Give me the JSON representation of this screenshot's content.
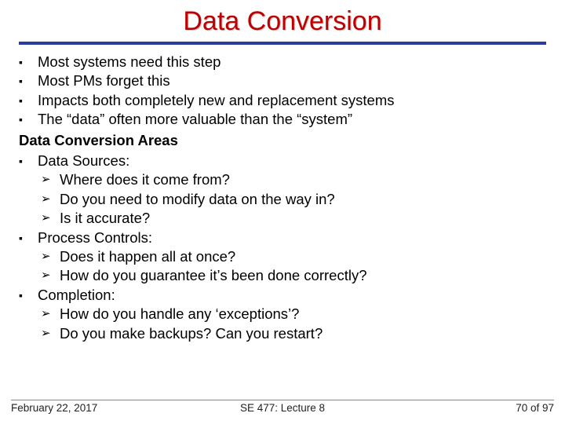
{
  "title": "Data Conversion",
  "bullets": {
    "b1": "Most systems need this step",
    "b2": "Most PMs forget this",
    "b3": "Impacts both completely new and replacement systems",
    "b4": "The “data” often more valuable than the “system”"
  },
  "subhead": "Data Conversion Areas",
  "sections": {
    "s1": {
      "label": "Data Sources:",
      "items": {
        "i1": "Where does it come from?",
        "i2": "Do you need to modify data on the way in?",
        "i3": "Is it accurate?"
      }
    },
    "s2": {
      "label": "Process Controls:",
      "items": {
        "i1": "Does it happen all at once?",
        "i2": "How do you guarantee it’s been done correctly?"
      }
    },
    "s3": {
      "label": "Completion:",
      "items": {
        "i1": "How do you handle any ‘exceptions’?",
        "i2": "Do you make backups? Can you restart?"
      }
    }
  },
  "footer": {
    "left": "February 22, 2017",
    "center": "SE 477: Lecture 8",
    "right": "70 of 97"
  },
  "glyphs": {
    "square": "▪",
    "arrow": "➢"
  }
}
